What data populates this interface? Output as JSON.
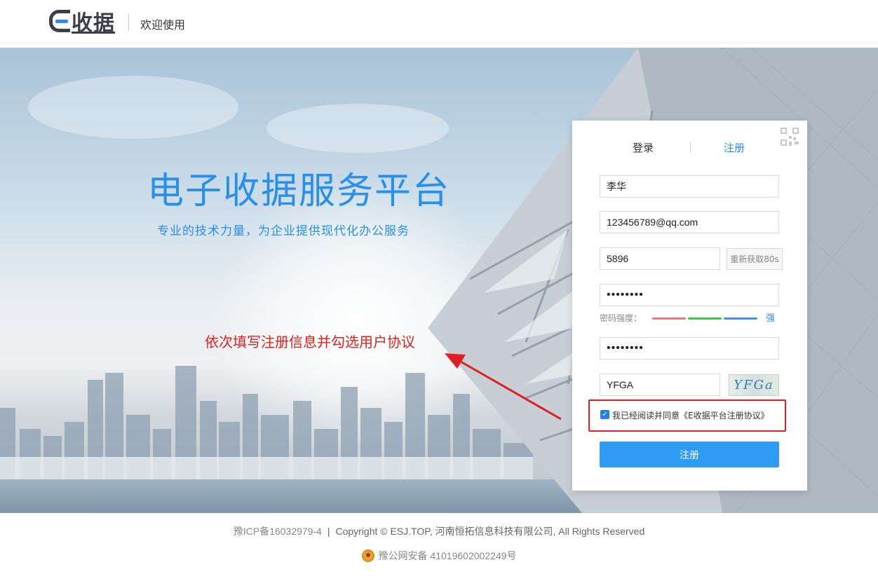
{
  "header": {
    "logo_text": "收据",
    "welcome": "欢迎使用"
  },
  "hero": {
    "title": "电子收据服务平台",
    "subtitle": "专业的技术力量，为企业提供现代化办公服务",
    "annotation": "依次填写注册信息并勾选用户协议"
  },
  "panel": {
    "tabs": [
      {
        "label": "登录",
        "active": false
      },
      {
        "label": "注册",
        "active": true
      }
    ],
    "fields": {
      "name": "李华",
      "email": "123456789@qq.com",
      "sms_code": "5896",
      "password": "••••••••",
      "password_confirm": "••••••••",
      "captcha": "YFGA"
    },
    "resend_label": "重新获取80s",
    "strength_label": "密码强度：",
    "strength_value": "强",
    "captcha_image_text": "YFGa",
    "agree_checked": true,
    "agree_prefix": "我已经阅读并同意",
    "agree_link": "《E收据平台注册协议》",
    "submit_label": "注册"
  },
  "footer": {
    "icp": "豫ICP备16032979-4",
    "separator": "|",
    "copyright": "Copyright © ESJ.TOP, 河南恒拓信息科技有限公司, All Rights Reserved",
    "police": "豫公网安备 41019602002249号"
  },
  "colors": {
    "accent": "#2a8fe6",
    "button": "#2e9cf5",
    "annotation": "#e02020"
  }
}
